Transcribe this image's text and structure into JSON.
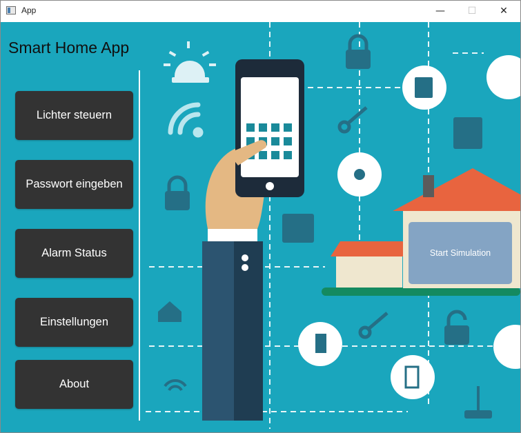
{
  "window": {
    "title": "App",
    "min_glyph": "—",
    "max_glyph": "☐",
    "close_glyph": "✕"
  },
  "app": {
    "heading": "Smart Home App"
  },
  "nav": {
    "items": [
      {
        "label": "Lichter steuern"
      },
      {
        "label": "Passwort eingeben"
      },
      {
        "label": "Alarm Status"
      },
      {
        "label": "Einstellungen"
      },
      {
        "label": "About"
      }
    ]
  },
  "simulation": {
    "button_label": "Start Simulation"
  },
  "colors": {
    "background": "#1aa6bd",
    "nav_button": "#333333",
    "sim_button": "#84a4c4"
  }
}
